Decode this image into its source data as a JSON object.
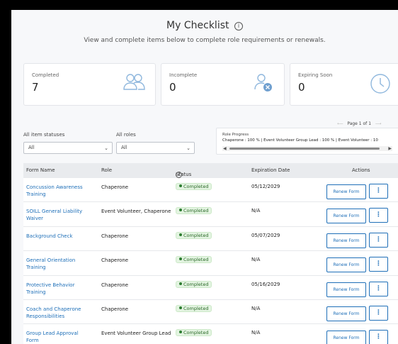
{
  "header": {
    "title": "My Checklist",
    "info_glyph": "i",
    "subtitle": "View and complete items below to complete role requirements or renewals."
  },
  "summary": [
    {
      "label": "Completed",
      "value": "7",
      "icon": "people-icon"
    },
    {
      "label": "Incomplete",
      "value": "0",
      "icon": "user-cancel-icon"
    },
    {
      "label": "Expiring Soon",
      "value": "0",
      "icon": "clock-icon"
    }
  ],
  "filters": {
    "status_label": "All item statuses",
    "status_value": "All",
    "roles_label": "All roles",
    "roles_value": "All"
  },
  "pager": {
    "prev": "⟵",
    "text": "Page 1 of 1",
    "next": "⟶"
  },
  "role_progress": {
    "heading": "Role Progress",
    "line": "Chaperone : 100 %   |   Event Volunteer Group Lead : 100 %   |   Event Volunteer : 10"
  },
  "table": {
    "headers": {
      "name": "Form Name",
      "role": "Role",
      "status": "Status",
      "expiration": "Expiration Date",
      "actions": "Actions"
    },
    "rows": [
      {
        "name": "Concussion Awareness Training",
        "role": "Chaperone",
        "status": "Completed",
        "expiration": "05/12/2029",
        "action": "Renew Form",
        "more": "⋮"
      },
      {
        "name": "SOILL General Liability Waiver",
        "role": "Event Volunteer, Chaperone",
        "status": "Completed",
        "expiration": "N/A",
        "action": "Renew Form",
        "more": "⋮"
      },
      {
        "name": "Background Check",
        "role": "Chaperone",
        "status": "Completed",
        "expiration": "05/07/2029",
        "action": "Renew Form",
        "more": "⋮"
      },
      {
        "name": "General Orientation Training",
        "role": "Chaperone",
        "status": "Completed",
        "expiration": "N/A",
        "action": "Renew Form",
        "more": "⋮"
      },
      {
        "name": "Protective Behavior Training",
        "role": "Chaperone",
        "status": "Completed",
        "expiration": "05/16/2029",
        "action": "Renew Form",
        "more": "⋮"
      },
      {
        "name": "Coach and Chaperone Responsibilities",
        "role": "Chaperone",
        "status": "Completed",
        "expiration": "N/A",
        "action": "Renew Form",
        "more": "⋮"
      },
      {
        "name": "Group Lead Approval Form",
        "role": "Event Volunteer Group Lead",
        "status": "Completed",
        "expiration": "N/A",
        "action": "Renew Form",
        "more": "⋮"
      }
    ]
  },
  "colors": {
    "link": "#1e6fb8",
    "status_bg": "#e3f4e1",
    "status_text": "#2d6a2a",
    "accent_icon": "#8fb7dd"
  }
}
